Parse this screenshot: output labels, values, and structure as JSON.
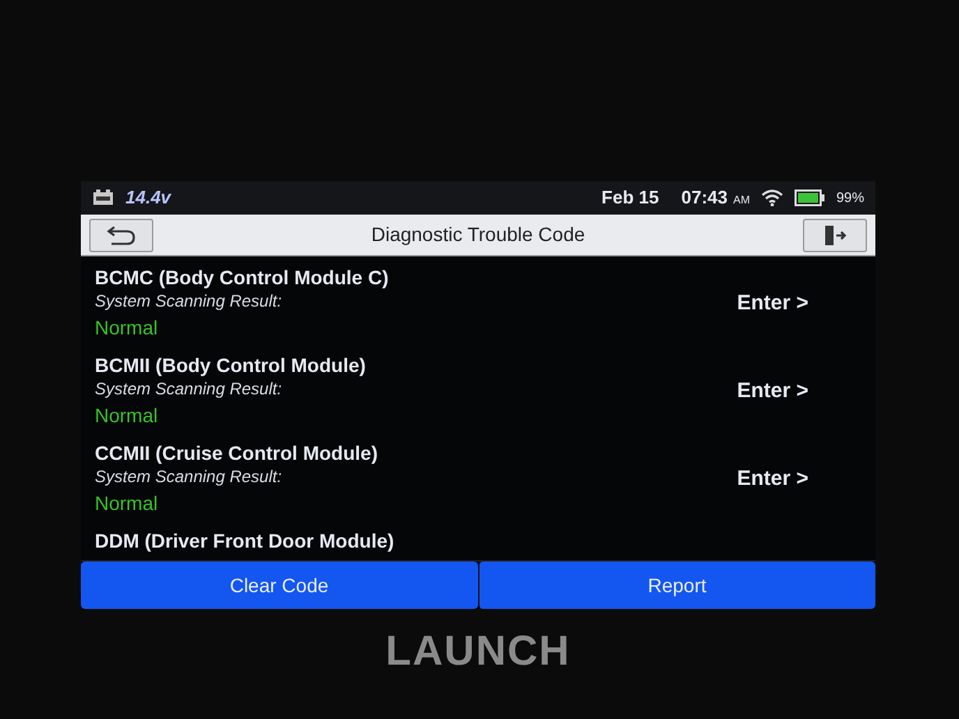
{
  "status_bar": {
    "voltage": "14.4v",
    "date": "Feb 15",
    "time": "07:43",
    "meridiem": "AM",
    "battery": "99%"
  },
  "title_bar": {
    "title": "Diagnostic Trouble Code"
  },
  "modules": [
    {
      "name": "BCMC (Body Control Module C)",
      "label": "System Scanning Result:",
      "result": "Normal",
      "action": "Enter >"
    },
    {
      "name": "BCMII (Body Control Module)",
      "label": "System Scanning Result:",
      "result": "Normal",
      "action": "Enter >"
    },
    {
      "name": "CCMII (Cruise Control Module)",
      "label": "System Scanning Result:",
      "result": "Normal",
      "action": "Enter >"
    },
    {
      "name": "DDM (Driver Front Door Module)"
    }
  ],
  "buttons": [
    "Clear Code",
    "Report"
  ],
  "device_logo": "LAUNCH"
}
